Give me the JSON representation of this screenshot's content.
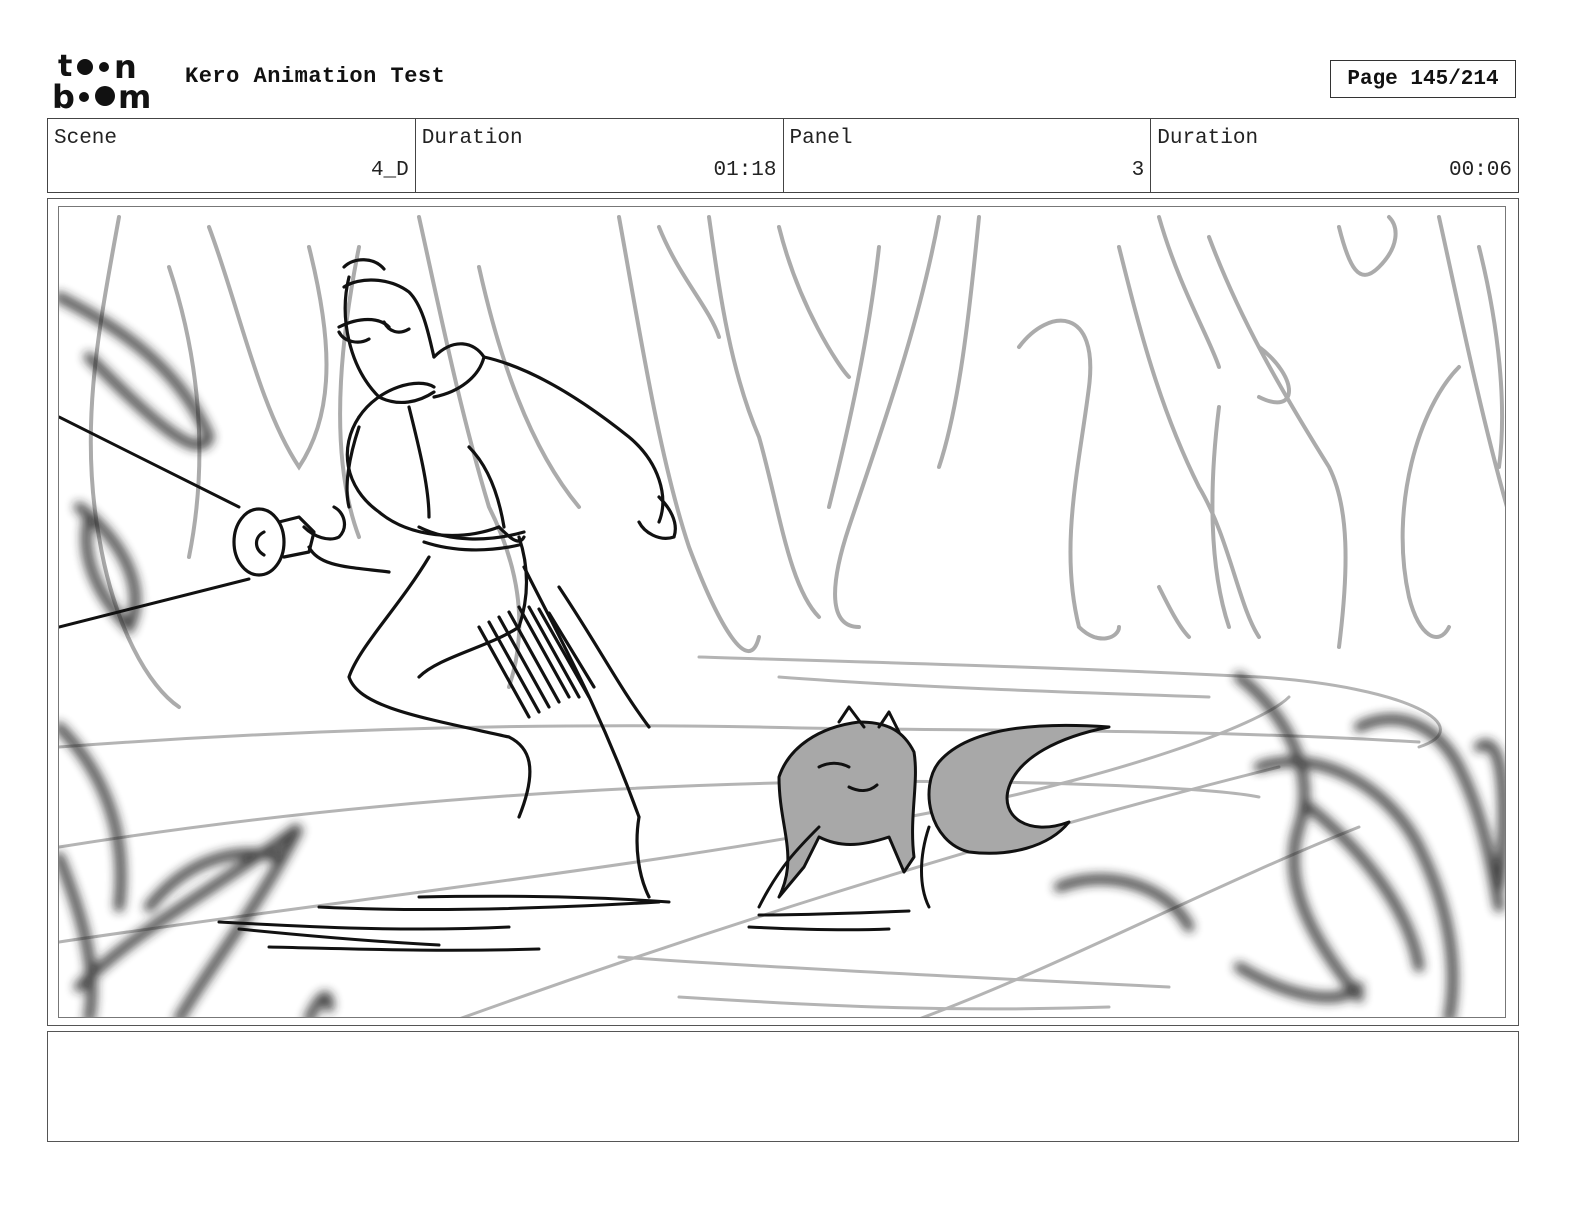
{
  "header": {
    "logo_top": "toon",
    "logo_bottom": "boom",
    "project_title": "Kero Animation Test",
    "page_label": "Page 145/214"
  },
  "info": {
    "scene_label": "Scene",
    "scene_value": "4_D",
    "scene_duration_label": "Duration",
    "scene_duration_value": "01:18",
    "panel_label": "Panel",
    "panel_value": "3",
    "panel_duration_label": "Duration",
    "panel_duration_value": "00:06"
  },
  "notes": {
    "text": ""
  },
  "colors": {
    "ink": "#111111",
    "sketch_gray": "#aaaaaa",
    "fill_gray": "#a6a6a6",
    "border": "#444444"
  }
}
